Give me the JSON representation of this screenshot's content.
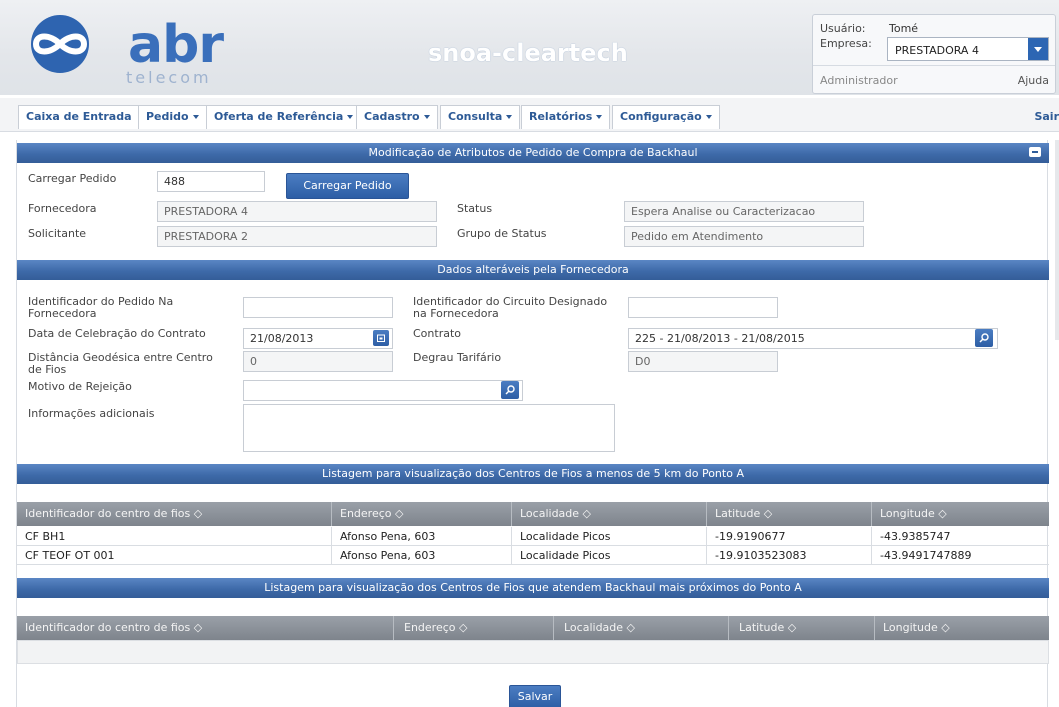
{
  "header": {
    "logo_text": "abr",
    "logo_sub": "telecom",
    "app_title": "snoa-cleartech",
    "user_label": "Usuário:",
    "user_value": "Tomé",
    "company_label": "Empresa:",
    "company_value": "PRESTADORA 4",
    "role": "Administrador",
    "help": "Ajuda"
  },
  "nav": {
    "items": [
      {
        "label": "Caixa de Entrada"
      },
      {
        "label": "Pedido"
      },
      {
        "label": "Oferta de Referência"
      },
      {
        "label": "Cadastro"
      },
      {
        "label": "Consulta"
      },
      {
        "label": "Relatórios"
      },
      {
        "label": "Configuração"
      }
    ],
    "exit": "Sair"
  },
  "section1": {
    "title": "Modificação de Atributos de Pedido de Compra de Backhaul",
    "load_label": "Carregar Pedido",
    "load_value": "488",
    "load_button": "Carregar Pedido",
    "supplier_label": "Fornecedora",
    "supplier_value": "PRESTADORA 4",
    "requester_label": "Solicitante",
    "requester_value": "PRESTADORA 2",
    "status_label": "Status",
    "status_value": "Espera Analise ou Caracterizacao",
    "status_group_label": "Grupo de Status",
    "status_group_value": "Pedido em Atendimento"
  },
  "section2": {
    "title": "Dados alteráveis pela Fornecedora",
    "order_id_label": "Identificador do Pedido Na Fornecedora",
    "order_id_value": "",
    "circuit_id_label": "Identificador do Circuito Designado na Fornecedora",
    "circuit_id_value": "",
    "contract_date_label": "Data de Celebração do Contrato",
    "contract_date_value": "21/08/2013",
    "contract_label": "Contrato",
    "contract_value": "225 - 21/08/2013 - 21/08/2015",
    "distance_label": "Distância Geodésica entre Centro de Fios",
    "distance_value": "0",
    "tariff_label": "Degrau Tarifário",
    "tariff_value": "D0",
    "rejection_label": "Motivo de Rejeição",
    "rejection_value": "",
    "info_label": "Informações adicionais",
    "info_value": ""
  },
  "section3": {
    "title": "Listagem para visualização dos Centros de Fios a menos de 5 km do Ponto A",
    "columns": [
      "Identificador do centro de fios ◇",
      "Endereço ◇",
      "Localidade ◇",
      "Latitude ◇",
      "Longitude ◇"
    ],
    "rows": [
      [
        "CF BH1",
        "Afonso Pena, 603",
        "Localidade Picos",
        "-19.9190677",
        "-43.9385747"
      ],
      [
        "CF TEOF OT 001",
        "Afonso Pena, 603",
        "Localidade Picos",
        "-19.9103523083",
        "-43.9491747889"
      ]
    ]
  },
  "section4": {
    "title": "Listagem para visualização dos Centros de Fios que atendem Backhaul mais próximos do Ponto A",
    "columns": [
      "Identificador do centro de fios ◇",
      "Endereço ◇",
      "Localidade ◇",
      "Latitude ◇",
      "Longitude ◇"
    ]
  },
  "footer": {
    "save_button": "Salvar"
  }
}
